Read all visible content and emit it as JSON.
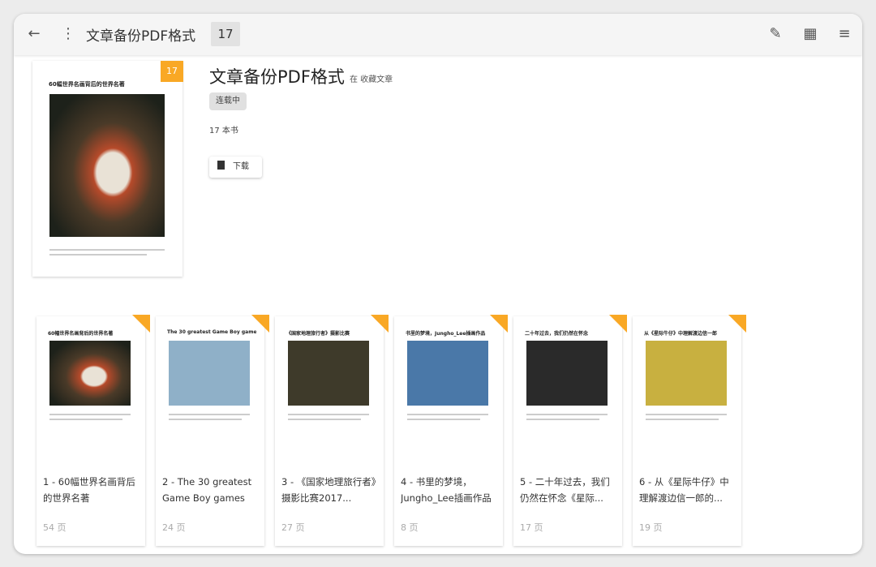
{
  "topbar": {
    "title": "文章备份PDF格式",
    "count": "17"
  },
  "cover": {
    "badge": "17",
    "caption": "60幅世界名画背后的世界名著"
  },
  "header": {
    "title": "文章备份PDF格式",
    "subtitle": "在 收藏文章",
    "status": "连载中",
    "book_count": "17 本书",
    "download_label": "下载"
  },
  "books": [
    {
      "title": "1 - 60幅世界名画背后的世界名著",
      "pages": "54 页",
      "caption": "60幅世界名画背后的世界名著",
      "color": "painting"
    },
    {
      "title": "2 - The 30 greatest Game Boy games -...",
      "pages": "24 页",
      "caption": "The 30 greatest Game Boy games",
      "color": "#8fb0c8"
    },
    {
      "title": "3 - 《国家地理旅行者》摄影比赛2017...",
      "pages": "27 页",
      "caption": "《国家地理旅行者》摄影比赛",
      "color": "#3e3a2a"
    },
    {
      "title": "4 - 书里的梦境，Jungho_Lee插画作品",
      "pages": "8 页",
      "caption": "书里的梦境，Jungho_Lee插画作品",
      "color": "#4a78a8"
    },
    {
      "title": "5 - 二十年过去，我们仍然在怀念《星际...",
      "pages": "17 页",
      "caption": "二十年过去，我们仍然在怀念",
      "color": "#2a2a2a"
    },
    {
      "title": "6 - 从《星际牛仔》中理解渡边信一郎的...",
      "pages": "19 页",
      "caption": "从《星际牛仔》中理解渡边信一郎",
      "color": "#c8b040"
    }
  ]
}
